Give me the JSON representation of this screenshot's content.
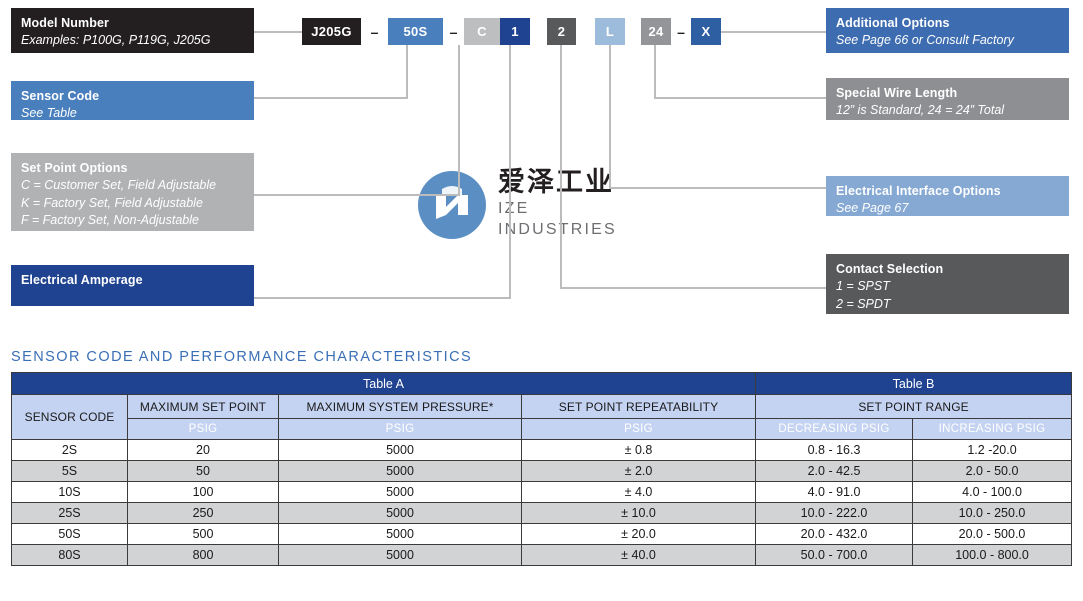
{
  "watermark": {
    "cn_text": "爱泽工业",
    "en_text": "IZE INDUSTRIES",
    "mark_icon": "circle-n-logo-icon",
    "mark_color": "#5b8fc4"
  },
  "model_code": {
    "chips": [
      {
        "label": "J205G",
        "color": "#231f20",
        "style": "k-black"
      },
      {
        "label": "–",
        "color": "#231f20",
        "style": "dash"
      },
      {
        "label": "50S",
        "color": "#4a7fbd",
        "style": "k-blue"
      },
      {
        "label": "–",
        "color": "#231f20",
        "style": "dash"
      },
      {
        "label": "C",
        "color": "#bcbec0",
        "style": "k-ltgry"
      },
      {
        "label": "1",
        "color": "#1f4391",
        "style": "k-navy"
      },
      {
        "label": "2",
        "color": "#58595b",
        "style": "k-dgry"
      },
      {
        "label": "L",
        "color": "#9dbcdc",
        "style": "k-lblue"
      },
      {
        "label": "24",
        "color": "#939598",
        "style": "k-mgry"
      },
      {
        "label": "–",
        "color": "#231f20",
        "style": "dash"
      },
      {
        "label": "X",
        "color": "#2e5fa3",
        "style": "k-mblue"
      }
    ]
  },
  "callouts": {
    "left": [
      {
        "title": "Model Number",
        "lines": [
          "Examples: P100G, P119G, J205G"
        ],
        "color": "#231f20"
      },
      {
        "title": "Sensor Code",
        "lines": [
          "See Table"
        ],
        "color": "#4a7fbd"
      },
      {
        "title": "Set Point Options",
        "lines": [
          "C = Customer Set, Field Adjustable",
          "K = Factory Set, Field Adjustable",
          "F = Factory Set, Non-Adjustable"
        ],
        "color": "#b0b2b4"
      },
      {
        "title": "Electrical Amperage",
        "lines": [],
        "color": "#1f4391"
      }
    ],
    "right": [
      {
        "title": "Additional Options",
        "lines": [
          "See Page 66 or Consult Factory"
        ],
        "color": "#3d6cb0"
      },
      {
        "title": "Special Wire Length",
        "lines": [
          "12” is Standard, 24 = 24” Total"
        ],
        "color": "#8d8f92"
      },
      {
        "title": "Electrical Interface Options",
        "lines": [
          "See Page 67"
        ],
        "color": "#86a9d4"
      },
      {
        "title": "Contact Selection",
        "lines": [
          "1 = SPST",
          "2 = SPDT"
        ],
        "color": "#58595b"
      }
    ]
  },
  "section": {
    "title": "SENSOR CODE AND PERFORMANCE CHARACTERISTICS"
  },
  "table": {
    "group_headers": [
      {
        "label": "Table A",
        "span": 4
      },
      {
        "label": "Table B",
        "span": 2
      }
    ],
    "column_headers": [
      "SENSOR CODE",
      "MAXIMUM SET POINT",
      "MAXIMUM SYSTEM PRESSURE*",
      "SET POINT REPEATABILITY",
      "SET POINT RANGE"
    ],
    "unit_headers": [
      "",
      "PSIG",
      "PSIG",
      "PSIG",
      "DECREASING PSIG",
      "INCREASING PSIG"
    ],
    "rows": [
      {
        "sensor_code": "2S",
        "max_set_point": "20",
        "max_system_pressure": "5000",
        "repeatability": "± 0.8",
        "decreasing": "0.8 - 16.3",
        "increasing": "1.2 -20.0"
      },
      {
        "sensor_code": "5S",
        "max_set_point": "50",
        "max_system_pressure": "5000",
        "repeatability": "± 2.0",
        "decreasing": "2.0 - 42.5",
        "increasing": "2.0 - 50.0"
      },
      {
        "sensor_code": "10S",
        "max_set_point": "100",
        "max_system_pressure": "5000",
        "repeatability": "± 4.0",
        "decreasing": "4.0 - 91.0",
        "increasing": "4.0 - 100.0"
      },
      {
        "sensor_code": "25S",
        "max_set_point": "250",
        "max_system_pressure": "5000",
        "repeatability": "± 10.0",
        "decreasing": "10.0 - 222.0",
        "increasing": "10.0 - 250.0"
      },
      {
        "sensor_code": "50S",
        "max_set_point": "500",
        "max_system_pressure": "5000",
        "repeatability": "± 20.0",
        "decreasing": "20.0 - 432.0",
        "increasing": "20.0 - 500.0"
      },
      {
        "sensor_code": "80S",
        "max_set_point": "800",
        "max_system_pressure": "5000",
        "repeatability": "± 40.0",
        "decreasing": "50.0 - 700.0",
        "increasing": "100.0 - 800.0"
      }
    ]
  }
}
